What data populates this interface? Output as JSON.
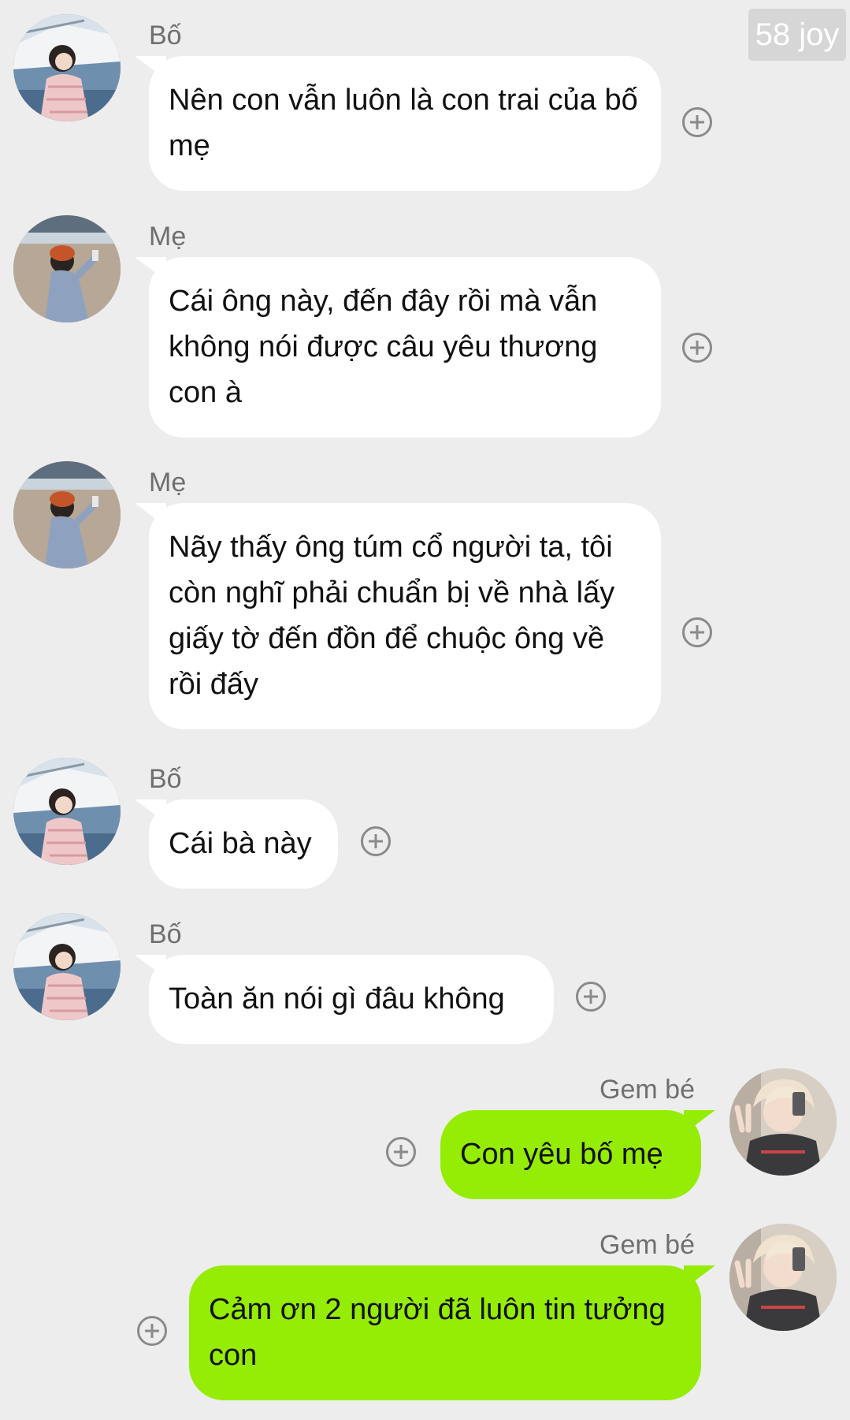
{
  "watermark": "58 joy",
  "messages": [
    {
      "sender": "Bố",
      "text": "Nên con vẫn luôn là con trai của bố mẹ",
      "side": "left",
      "avatar": "dad-avatar"
    },
    {
      "sender": "Mẹ",
      "text": "Cái ông này, đến đây rồi mà vẫn không nói được câu yêu thương con à",
      "side": "left",
      "avatar": "mom-avatar"
    },
    {
      "sender": "Mẹ",
      "text": "Nãy thấy ông túm cổ người ta, tôi còn nghĩ phải chuẩn bị về nhà lấy giấy tờ đến đồn để chuộc ông về rồi đấy",
      "side": "left",
      "avatar": "mom-avatar"
    },
    {
      "sender": "Bố",
      "text": "Cái bà này",
      "side": "left",
      "avatar": "dad-avatar"
    },
    {
      "sender": "Bố",
      "text": "Toàn ăn nói gì đâu không",
      "side": "left",
      "avatar": "dad-avatar"
    },
    {
      "sender": "Gem bé",
      "text": "Con yêu bố mẹ",
      "side": "right",
      "avatar": "gem-avatar"
    },
    {
      "sender": "Gem bé",
      "text": "Cảm ơn 2 người đã luôn tin tưởng con",
      "side": "right",
      "avatar": "gem-avatar"
    }
  ],
  "colors": {
    "background": "#ededed",
    "incoming_bubble": "#ffffff",
    "outgoing_bubble": "#95ec05"
  },
  "icons": {
    "action": "plus-circle-icon"
  }
}
